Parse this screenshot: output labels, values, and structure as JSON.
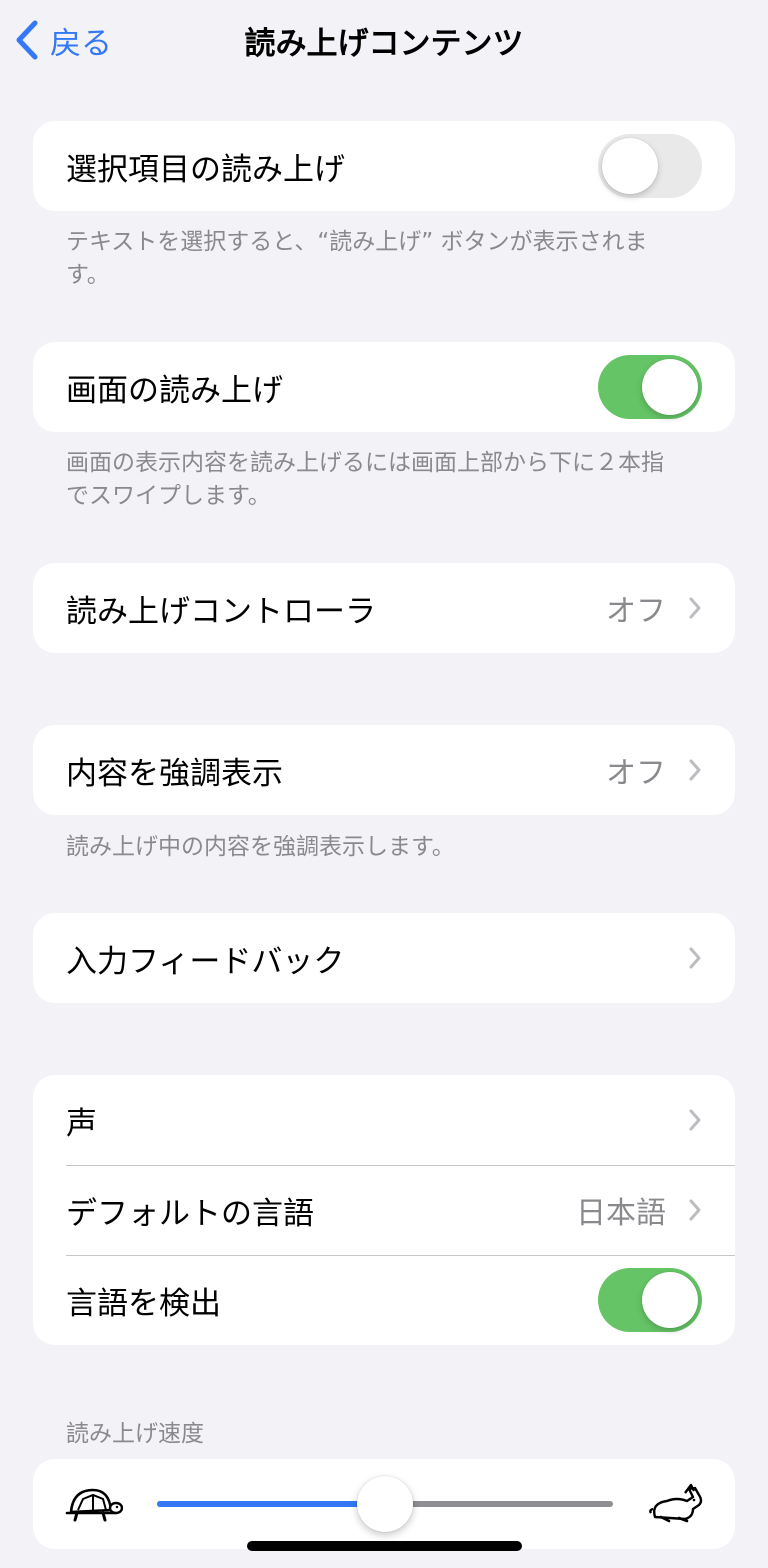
{
  "nav": {
    "back_label": "戻る",
    "title": "読み上げコンテンツ"
  },
  "speak_selection": {
    "label": "選択項目の読み上げ",
    "on": false,
    "footer": "テキストを選択すると、“読み上げ” ボタンが表示されます。"
  },
  "speak_screen": {
    "label": "画面の読み上げ",
    "on": true,
    "footer": "画面の表示内容を読み上げるには画面上部から下に２本指でスワイプします。"
  },
  "speech_controller": {
    "label": "読み上げコントローラ",
    "value": "オフ"
  },
  "highlight_content": {
    "label": "内容を強調表示",
    "value": "オフ",
    "footer": "読み上げ中の内容を強調表示します。"
  },
  "typing_feedback": {
    "label": "入力フィードバック"
  },
  "voice_group": {
    "voices_label": "声",
    "default_language_label": "デフォルトの言語",
    "default_language_value": "日本語",
    "detect_language_label": "言語を検出",
    "detect_language_on": true
  },
  "speaking_rate": {
    "header": "読み上げ速度",
    "value": 0.5
  },
  "icons": [
    "chevron-left-icon",
    "chevron-right-icon",
    "turtle-icon",
    "rabbit-icon"
  ],
  "colors": {
    "accent": "#3478F6",
    "toggle_on": "#65C466",
    "toggle_off": "#E9E9EA"
  }
}
